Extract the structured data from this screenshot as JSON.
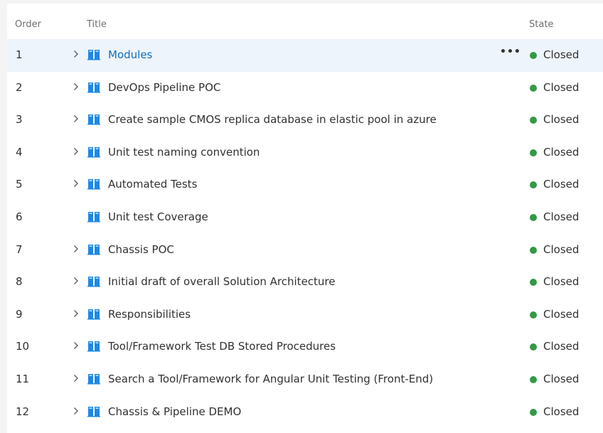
{
  "colors": {
    "state_closed": "#339947",
    "book_icon": "#1e88e5",
    "selected_row": "#eef4fb",
    "link": "#106ebe"
  },
  "header": {
    "order": "Order",
    "title": "Title",
    "state": "State"
  },
  "rows": [
    {
      "order": "1",
      "title": "Modules",
      "state": "Closed",
      "expandable": true,
      "selected": true,
      "more": "•••"
    },
    {
      "order": "2",
      "title": "DevOps Pipeline POC",
      "state": "Closed",
      "expandable": true
    },
    {
      "order": "3",
      "title": "Create sample CMOS replica database in elastic pool in azure",
      "state": "Closed",
      "expandable": true
    },
    {
      "order": "4",
      "title": "Unit test naming convention",
      "state": "Closed",
      "expandable": true
    },
    {
      "order": "5",
      "title": "Automated Tests",
      "state": "Closed",
      "expandable": true
    },
    {
      "order": "6",
      "title": "Unit test Coverage",
      "state": "Closed",
      "expandable": false
    },
    {
      "order": "7",
      "title": "Chassis POC",
      "state": "Closed",
      "expandable": true
    },
    {
      "order": "8",
      "title": "Initial draft of overall Solution Architecture",
      "state": "Closed",
      "expandable": true
    },
    {
      "order": "9",
      "title": "Responsibilities",
      "state": "Closed",
      "expandable": true
    },
    {
      "order": "10",
      "title": "Tool/Framework Test DB Stored Procedures",
      "state": "Closed",
      "expandable": true
    },
    {
      "order": "11",
      "title": "Search a Tool/Framework for Angular Unit Testing (Front-End)",
      "state": "Closed",
      "expandable": true
    },
    {
      "order": "12",
      "title": "Chassis & Pipeline DEMO",
      "state": "Closed",
      "expandable": true
    }
  ]
}
